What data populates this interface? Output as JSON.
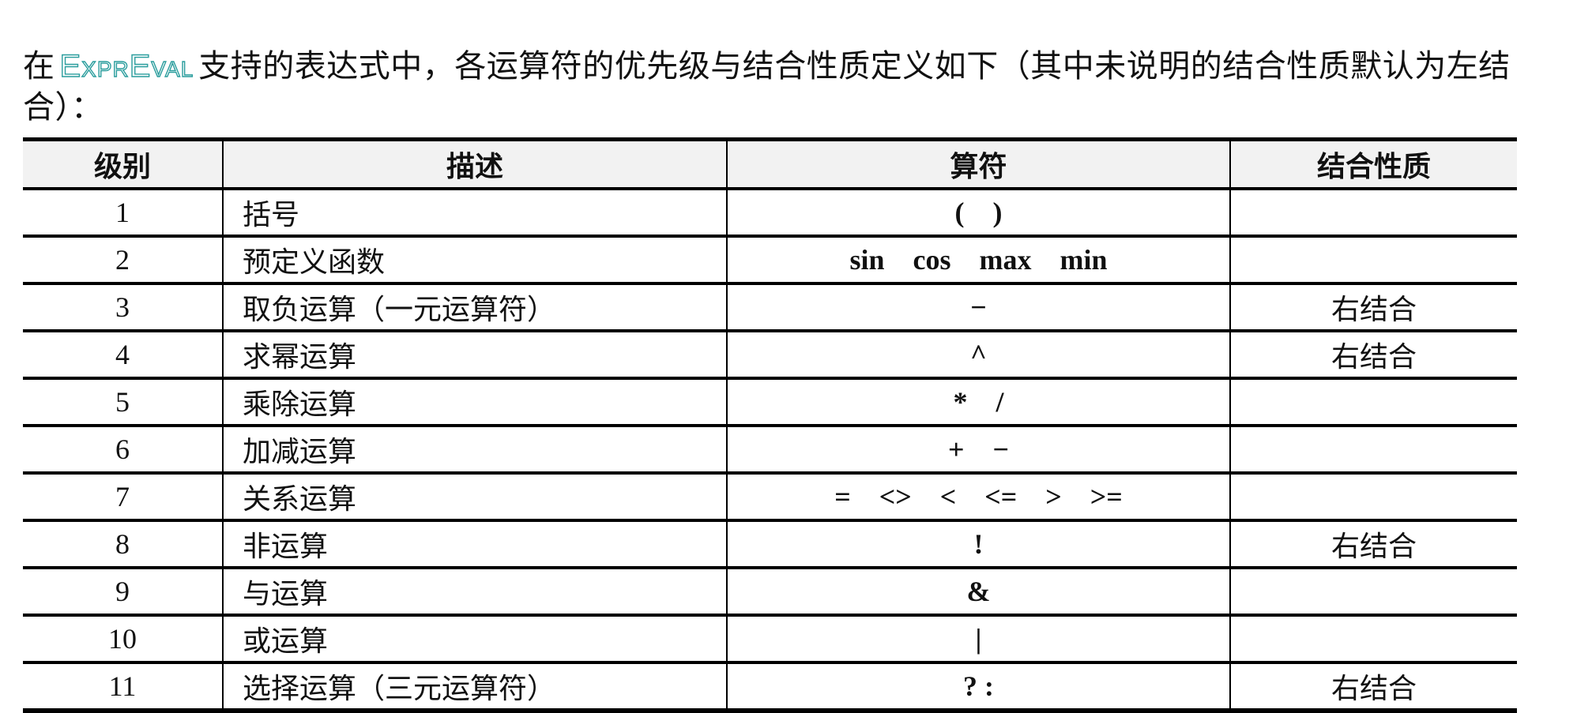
{
  "intro": {
    "prefix": "在",
    "brand": "ExprEval",
    "text": "支持的表达式中，各运算符的优先级与结合性质定义如下（其中未说明的结合性质默认为左结合）："
  },
  "table": {
    "headers": [
      "级别",
      "描述",
      "算符",
      "结合性质"
    ],
    "rows": [
      {
        "level": "1",
        "desc": "括号",
        "ops": "(    )",
        "assoc": ""
      },
      {
        "level": "2",
        "desc": "预定义函数",
        "ops": "sin    cos    max    min",
        "assoc": ""
      },
      {
        "level": "3",
        "desc": "取负运算（一元运算符）",
        "ops": "−",
        "assoc": "右结合"
      },
      {
        "level": "4",
        "desc": "求幂运算",
        "ops": "^",
        "assoc": "右结合"
      },
      {
        "level": "5",
        "desc": "乘除运算",
        "ops": "*    /",
        "assoc": ""
      },
      {
        "level": "6",
        "desc": "加减运算",
        "ops": "+    −",
        "assoc": ""
      },
      {
        "level": "7",
        "desc": "关系运算",
        "ops": "=    <>    <    <=    >    >=",
        "assoc": ""
      },
      {
        "level": "8",
        "desc": "非运算",
        "ops": "!",
        "assoc": "右结合"
      },
      {
        "level": "9",
        "desc": "与运算",
        "ops": "&",
        "assoc": ""
      },
      {
        "level": "10",
        "desc": "或运算",
        "ops": "|",
        "assoc": ""
      },
      {
        "level": "11",
        "desc": "选择运算（三元运算符）",
        "ops": "? :",
        "assoc": "右结合"
      }
    ]
  }
}
